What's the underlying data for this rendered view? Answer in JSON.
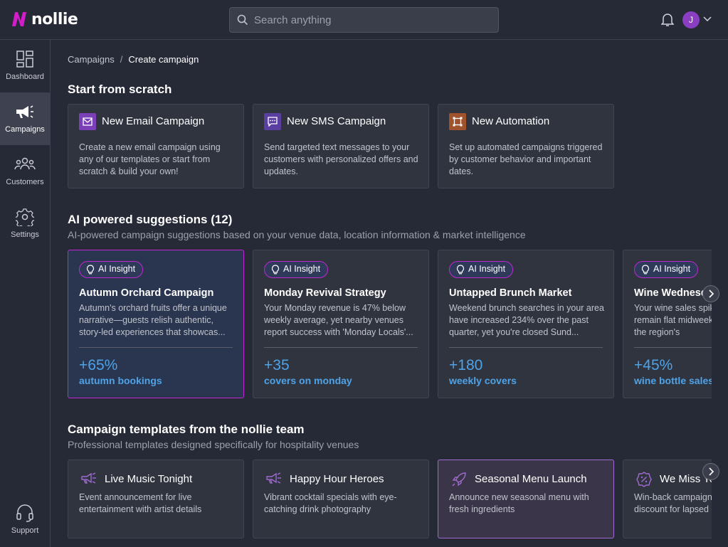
{
  "brand": {
    "name": "nollie",
    "accent": "#d21ec8"
  },
  "search": {
    "placeholder": "Search anything"
  },
  "user": {
    "initial": "J"
  },
  "sidebar": {
    "items": [
      {
        "label": "Dashboard",
        "icon": "dashboard-icon",
        "active": false
      },
      {
        "label": "Campaigns",
        "icon": "megaphone-icon",
        "active": true
      },
      {
        "label": "Customers",
        "icon": "users-icon",
        "active": false
      },
      {
        "label": "Settings",
        "icon": "gear-icon",
        "active": false
      }
    ],
    "support": {
      "label": "Support",
      "icon": "headset-icon"
    }
  },
  "breadcrumb": {
    "parent": "Campaigns",
    "separator": "/",
    "current": "Create campaign"
  },
  "scratch": {
    "heading": "Start from scratch",
    "cards": [
      {
        "title": "New Email Campaign",
        "desc": "Create a new email campaign using any of our templates or start from scratch & build your own!",
        "icon": "email-icon",
        "color": "#7b3fb8"
      },
      {
        "title": "New SMS Campaign",
        "desc": "Send targeted text messages to your customers with personalized offers and updates.",
        "icon": "sms-icon",
        "color": "#5a3fa0"
      },
      {
        "title": "New Automation",
        "desc": "Set up automated campaigns triggered by customer behavior and important dates.",
        "icon": "automation-icon",
        "color": "#a0522d"
      }
    ]
  },
  "ai": {
    "heading": "AI powered suggestions (12)",
    "subheading": "AI-powered campaign suggestions based on your venue data, location information & market intelligence",
    "badge": "AI Insight",
    "cards": [
      {
        "title": "Autumn Orchard Campaign",
        "desc": "Autumn's orchard fruits offer a unique narrative—guests relish authentic, story-led experiences that showcas...",
        "metric": "+65%",
        "metric_label": "autumn bookings"
      },
      {
        "title": "Monday Revival Strategy",
        "desc": "Your Monday revenue is 47% below weekly average, yet nearby venues report success with 'Monday Locals'...",
        "metric": "+35",
        "metric_label": "covers on monday"
      },
      {
        "title": "Untapped Brunch Market",
        "desc": "Weekend brunch searches in your area have increased 234% over the past quarter, yet you're closed Sund...",
        "metric": "+180",
        "metric_label": "weekly covers"
      },
      {
        "title": "Wine Wednesday",
        "desc": "Your wine sales spike on weekends but remain flat midweek, despite having the region's",
        "metric": "+45%",
        "metric_label": "wine bottle sales"
      }
    ]
  },
  "templates": {
    "heading": "Campaign templates from the nollie team",
    "subheading": "Professional templates designed specifically for hospitality venues",
    "cards": [
      {
        "title": "Live Music Tonight",
        "desc": "Event announcement for live entertainment with artist details",
        "icon": "megaphone-icon"
      },
      {
        "title": "Happy Hour Heroes",
        "desc": "Vibrant cocktail specials with eye-catching drink photography",
        "icon": "megaphone-icon"
      },
      {
        "title": "Seasonal Menu Launch",
        "desc": "Announce new seasonal menu with fresh ingredients",
        "icon": "rocket-icon"
      },
      {
        "title": "We Miss You",
        "desc": "Win-back campaign with personalized discount for lapsed customers",
        "icon": "discount-badge-icon"
      }
    ]
  }
}
